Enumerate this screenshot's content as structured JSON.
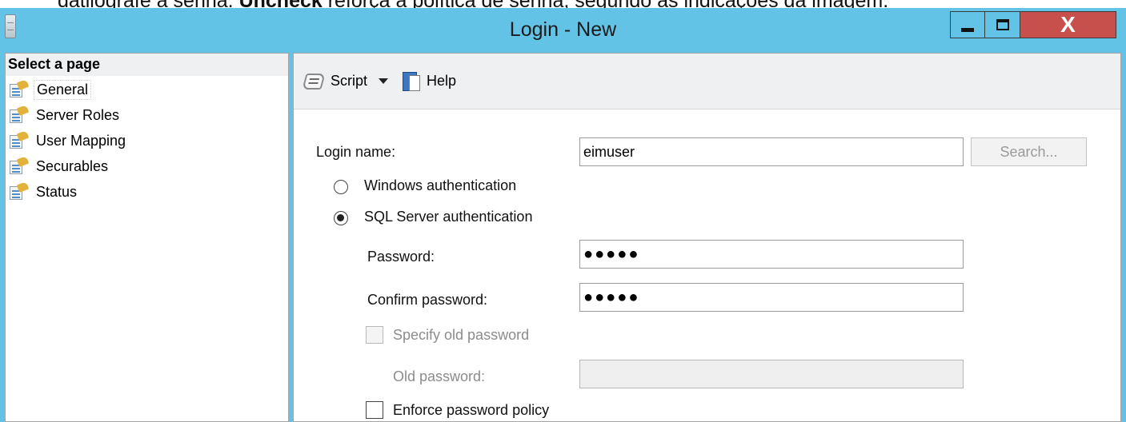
{
  "overlay": {
    "prefix": "datilografe a senha. ",
    "bold": "Uncheck",
    "suffix": " reforça a política de senha, segundo as indicações da imagem."
  },
  "window": {
    "title": "Login - New",
    "close_label": "X"
  },
  "sidebar": {
    "header": "Select a page",
    "items": [
      {
        "label": "General",
        "selected": true
      },
      {
        "label": "Server Roles"
      },
      {
        "label": "User Mapping"
      },
      {
        "label": "Securables"
      },
      {
        "label": "Status"
      }
    ]
  },
  "toolbar": {
    "script_label": "Script",
    "help_label": "Help"
  },
  "form": {
    "login_name_label": "Login name:",
    "login_name_value": "eimuser",
    "search_label": "Search...",
    "windows_auth_label": "Windows authentication",
    "sql_auth_label": "SQL Server authentication",
    "auth_selected": "SQL Server authentication",
    "password_label": "Password:",
    "password_value": "●●●●●",
    "confirm_label": "Confirm password:",
    "confirm_value": "●●●●●",
    "specify_old_label": "Specify old password",
    "old_password_label": "Old password:",
    "old_password_value": "",
    "enforce_policy_label": "Enforce password policy"
  },
  "colors": {
    "titlebar": "#63c3e6",
    "close_button": "#c7504c"
  }
}
